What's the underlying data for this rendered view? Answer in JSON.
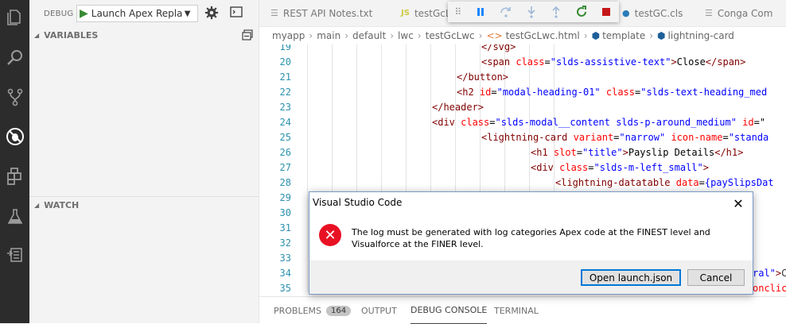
{
  "activity_bar": {
    "icons": [
      "files-icon",
      "search-icon",
      "source-control-icon",
      "debug-icon",
      "extensions-icon",
      "test-flask-icon",
      "org-browser-icon"
    ]
  },
  "sidebar": {
    "debug_label": "DEBUG",
    "launch_config": "Launch Apex Repla",
    "variables_header": "VARIABLES",
    "watch_header": "WATCH"
  },
  "tabs": [
    {
      "label": "REST API Notes.txt",
      "icon": "file-icon"
    },
    {
      "label": "testGcL",
      "icon": "js-icon",
      "icon_text": "JS"
    },
    {
      "label": "testGC.cls",
      "icon": "apex-icon"
    },
    {
      "label": "Conga Com",
      "icon": "file-icon"
    }
  ],
  "debug_toolbar": {
    "icons": [
      "gripper-icon",
      "pause-icon",
      "step-over-icon",
      "step-into-icon",
      "step-out-icon",
      "restart-icon",
      "stop-icon"
    ]
  },
  "breadcrumb": [
    "myapp",
    "main",
    "default",
    "lwc",
    "testGcLwc",
    "testGcLwc.html",
    "template",
    "lightning-card"
  ],
  "editor": {
    "lines": [
      {
        "n": "19",
        "indent": 7,
        "parts": [
          [
            "t",
            "</svg>"
          ]
        ]
      },
      {
        "n": "20",
        "indent": 7,
        "parts": [
          [
            "t",
            "<span "
          ],
          [
            "a",
            "class"
          ],
          [
            "p",
            "="
          ],
          [
            "s",
            "\"slds-assistive-text\""
          ],
          [
            "t",
            ">"
          ],
          [
            "p",
            "Close"
          ],
          [
            "t",
            "</span>"
          ]
        ]
      },
      {
        "n": "21",
        "indent": 6,
        "parts": [
          [
            "t",
            "</button>"
          ]
        ]
      },
      {
        "n": "22",
        "indent": 6,
        "parts": [
          [
            "t",
            "<h2 "
          ],
          [
            "a",
            "id"
          ],
          [
            "p",
            "="
          ],
          [
            "s",
            "\"modal-heading-01\""
          ],
          [
            "p",
            " "
          ],
          [
            "a",
            "class"
          ],
          [
            "p",
            "="
          ],
          [
            "s",
            "\"slds-text-heading_med"
          ]
        ]
      },
      {
        "n": "23",
        "indent": 5,
        "parts": [
          [
            "t",
            "</header>"
          ]
        ]
      },
      {
        "n": "24",
        "indent": 5,
        "parts": [
          [
            "t",
            "<div "
          ],
          [
            "a",
            "class"
          ],
          [
            "p",
            "="
          ],
          [
            "s",
            "\"slds-modal__content slds-p-around_medium\""
          ],
          [
            "p",
            " "
          ],
          [
            "a",
            "id"
          ],
          [
            "p",
            "=\""
          ]
        ]
      },
      {
        "n": "25",
        "indent": 7,
        "parts": [
          [
            "t",
            "<lightning-card "
          ],
          [
            "a",
            "variant"
          ],
          [
            "p",
            "="
          ],
          [
            "s",
            "\"narrow\""
          ],
          [
            "p",
            " "
          ],
          [
            "a",
            "icon-name"
          ],
          [
            "p",
            "="
          ],
          [
            "s",
            "\"standa"
          ]
        ]
      },
      {
        "n": "26",
        "indent": 9,
        "parts": [
          [
            "t",
            "<h1 "
          ],
          [
            "a",
            "slot"
          ],
          [
            "p",
            "="
          ],
          [
            "s",
            "\"title\""
          ],
          [
            "t",
            ">"
          ],
          [
            "p",
            "Payslip Details"
          ],
          [
            "t",
            "</h1>"
          ]
        ]
      },
      {
        "n": "27",
        "indent": 9,
        "parts": [
          [
            "t",
            "<div "
          ],
          [
            "a",
            "class"
          ],
          [
            "p",
            "="
          ],
          [
            "s",
            "\"slds-m-left_small\""
          ],
          [
            "t",
            ">"
          ]
        ]
      },
      {
        "n": "28",
        "indent": 10,
        "parts": [
          [
            "t",
            "<lightning-datatable "
          ],
          [
            "a",
            "data"
          ],
          [
            "p",
            "="
          ],
          [
            "s",
            "{paySlipsDat"
          ]
        ]
      },
      {
        "n": "29",
        "indent": 0,
        "parts": []
      },
      {
        "n": "30",
        "indent": 0,
        "parts": []
      },
      {
        "n": "31",
        "indent": 0,
        "parts": []
      },
      {
        "n": "32",
        "indent": 0,
        "parts": []
      },
      {
        "n": "33",
        "indent": 0,
        "parts": []
      },
      {
        "n": "34",
        "indent": 0,
        "parts": []
      },
      {
        "n": "35",
        "indent": 0,
        "parts": []
      }
    ],
    "overflow_fragments": [
      {
        "line": "34",
        "parts": [
          [
            "s",
            "ral\""
          ],
          [
            "t",
            ">"
          ],
          [
            "p",
            "C"
          ]
        ]
      },
      {
        "line": "35",
        "parts": [
          [
            "a",
            "onclic"
          ]
        ]
      }
    ]
  },
  "panel": {
    "tabs": [
      {
        "label": "PROBLEMS",
        "badge": "164"
      },
      {
        "label": "OUTPUT"
      },
      {
        "label": "DEBUG CONSOLE",
        "active": true
      },
      {
        "label": "TERMINAL"
      }
    ]
  },
  "dialog": {
    "title": "Visual Studio Code",
    "message": "The log must be generated with log categories Apex code at the FINEST level and Visualforce at the FINER level.",
    "primary_button": "Open launch.json",
    "cancel_button": "Cancel"
  },
  "colors": {
    "activity_bg": "#2c2c2c",
    "sidebar_bg": "#f3f3f3",
    "tag": "#800000",
    "attr": "#ff0000",
    "string": "#0000ff",
    "line_number": "#2b91af",
    "error": "#e81123",
    "accent": "#0078d7"
  }
}
